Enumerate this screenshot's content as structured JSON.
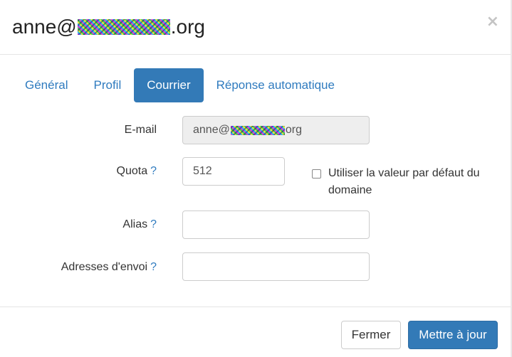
{
  "header": {
    "title_prefix": "anne@",
    "title_suffix": ".org",
    "close_symbol": "×"
  },
  "tabs": [
    {
      "label": "Général",
      "active": false
    },
    {
      "label": "Profil",
      "active": false
    },
    {
      "label": "Courrier",
      "active": true
    },
    {
      "label": "Réponse automatique",
      "active": false
    }
  ],
  "form": {
    "email": {
      "label": "E-mail",
      "value_prefix": "anne@",
      "value_suffix": "org"
    },
    "quota": {
      "label": "Quota",
      "help": "?",
      "value": "512"
    },
    "use_default": {
      "label": "Utiliser la valeur par défaut du domaine",
      "checked": false
    },
    "alias": {
      "label": "Alias",
      "help": "?",
      "value": ""
    },
    "send_addresses": {
      "label": "Adresses d'envoi",
      "help": "?",
      "value": ""
    }
  },
  "footer": {
    "close_label": "Fermer",
    "update_label": "Mettre à jour"
  },
  "colors": {
    "primary": "#337ab7",
    "link": "#2f7bbf",
    "readonly_bg": "#eeeeee"
  }
}
